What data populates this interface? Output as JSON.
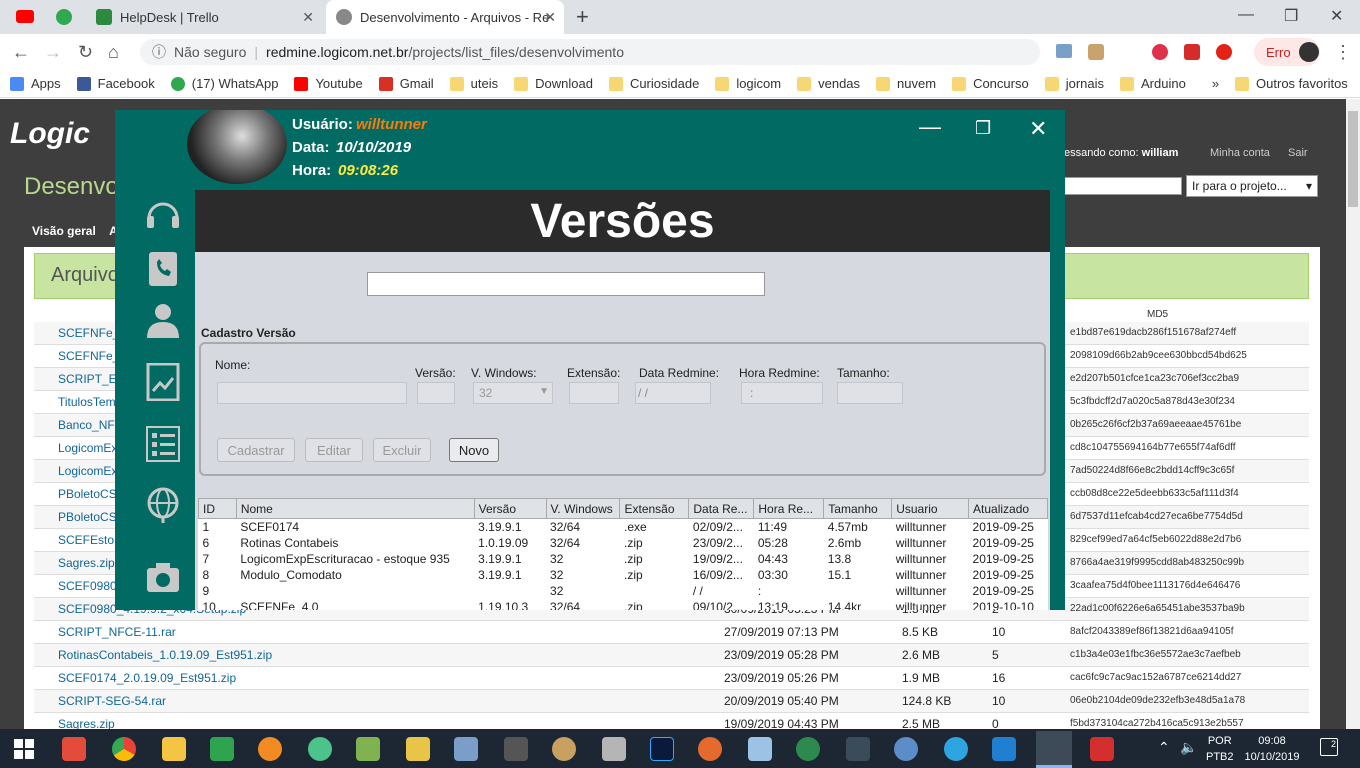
{
  "browser": {
    "tabs": [
      {
        "label": "HelpDesk | Trello"
      },
      {
        "label": "Desenvolvimento - Arquivos - Re"
      }
    ],
    "address_prefix": "Não seguro",
    "url_host": "redmine.logicom.net.br",
    "url_path": "/projects/list_files/desenvolvimento",
    "error_label": "Erro",
    "bookmarks": [
      "Apps",
      "Facebook",
      "(17) WhatsApp",
      "Youtube",
      "Gmail",
      "uteis",
      "Download",
      "Curiosidade",
      "logicom",
      "vendas",
      "nuvem",
      "Concurso",
      "jornais",
      "Arduino",
      "»",
      "Outros favoritos"
    ]
  },
  "redmine": {
    "logo": "Logic",
    "project": "Desenvo",
    "nav_first": "Visão geral",
    "nav_second": "A",
    "section_title": "Arquivo",
    "logged_prefix": "essando como:",
    "logged_user": "william",
    "my_account": "Minha conta",
    "logout": "Sair",
    "jump_label": "Ir para o projeto...",
    "md5_header": "MD5",
    "files": [
      {
        "name": "SCEFNFe_",
        "date": "",
        "size": "",
        "dl": "",
        "md5": "e1bd87e619dacb286f151678af274eff"
      },
      {
        "name": "SCEFNFe_",
        "date": "",
        "size": "",
        "dl": "",
        "md5": "2098109d66b2ab9cee630bbcd54bd625"
      },
      {
        "name": "SCRIPT_E",
        "date": "",
        "size": "",
        "dl": "",
        "md5": "e2d207b501cfce1ca23c706ef3cc2ba9"
      },
      {
        "name": "TitulosTem",
        "date": "",
        "size": "",
        "dl": "",
        "md5": "5c3fbdcff2d7a020c5a878d43e30f234"
      },
      {
        "name": "Banco_NF",
        "date": "",
        "size": "",
        "dl": "",
        "md5": "0b265c26f6cf2b37a69aeeaae45761be"
      },
      {
        "name": "LogicomEx",
        "date": "",
        "size": "",
        "dl": "",
        "md5": "cd8c104755694164b77e655f74af6dff"
      },
      {
        "name": "LogicomEx",
        "date": "",
        "size": "",
        "dl": "",
        "md5": "7ad50224d8f66e8c2bdd14cff9c3c65f"
      },
      {
        "name": "PBoletoCS",
        "date": "",
        "size": "",
        "dl": "",
        "md5": "ccb08d8ce22e5deebb633c5af111d3f4"
      },
      {
        "name": "PBoletoCS",
        "date": "",
        "size": "",
        "dl": "",
        "md5": "6d7537d11efcab4cd27eca6be7754d5d"
      },
      {
        "name": "SCEFEsto",
        "date": "",
        "size": "",
        "dl": "",
        "md5": "829cef99ed7a64cf5eb6022d88e2d7b6"
      },
      {
        "name": "Sagres.zip",
        "date": "",
        "size": "",
        "dl": "",
        "md5": "8766a4ae319f9995cdd8ab483250c99b"
      },
      {
        "name": "SCEF0980",
        "date": "",
        "size": "",
        "dl": "",
        "md5": "3caafea75d4f0bee1113176d4e646476"
      },
      {
        "name": "SCEF0980_4.19.9.2_x64.Setup.zip",
        "date": "30/09/2019 05:23 PM",
        "size": "1.5 MB",
        "dl": "2",
        "md5": "22ad1c00f6226e6a65451abe3537ba9b"
      },
      {
        "name": "SCRIPT_NFCE-11.rar",
        "date": "27/09/2019 07:13 PM",
        "size": "8.5 KB",
        "dl": "10",
        "md5": "8afcf2043389ef86f13821d6aa94105f"
      },
      {
        "name": "RotinasContabeis_1.0.19.09_Est951.zip",
        "date": "23/09/2019 05:28 PM",
        "size": "2.6 MB",
        "dl": "5",
        "md5": "c1b3a4e03e1fbc36e5572ae3c7aefbeb"
      },
      {
        "name": "SCEF0174_2.0.19.09_Est951.zip",
        "date": "23/09/2019 05:26 PM",
        "size": "1.9 MB",
        "dl": "16",
        "md5": "cac6fc9c7ac9ac152a6787ce6214dd27"
      },
      {
        "name": "SCRIPT-SEG-54.rar",
        "date": "20/09/2019 05:40 PM",
        "size": "124.8 KB",
        "dl": "10",
        "md5": "06e0b2104de09de232efb3e48d5a1a78"
      },
      {
        "name": "Sagres.zip",
        "date": "19/09/2019 04:43 PM",
        "size": "2.5 MB",
        "dl": "0",
        "md5": "f5bd373104ca272b416ca5c913e2b557"
      }
    ]
  },
  "app": {
    "user_label": "Usuário:",
    "user_value": "willtunner",
    "date_label": "Data:",
    "date_value": "10/10/2019",
    "time_label": "Hora:",
    "time_value": "09:08:26",
    "banner": "Versões",
    "section": "Cadastro Versão",
    "form": {
      "nome": "Nome:",
      "versao": "Versão:",
      "vwindows": "V. Windows:",
      "vwindows_value": "32",
      "extensao": "Extensão:",
      "data_redmine": "Data Redmine:",
      "data_value": " / /",
      "hora_redmine": "Hora Redmine:",
      "hora_value": ":",
      "tamanho": "Tamanho:"
    },
    "buttons": {
      "cadastrar": "Cadastrar",
      "editar": "Editar",
      "excluir": "Excluir",
      "novo": "Novo"
    },
    "columns": [
      "ID",
      "Nome",
      "Versão",
      "V. Windows",
      "Extensão",
      "Data Re...",
      "Hora Re...",
      "Tamanho",
      "Usuario",
      "Atualizado"
    ],
    "rows": [
      [
        "1",
        "SCEF0174",
        "3.19.9.1",
        "32/64",
        ".exe",
        "02/09/2...",
        "11:49",
        "4.57mb",
        "willtunner",
        "2019-09-25"
      ],
      [
        "6",
        "Rotinas Contabeis",
        "1.0.19.09",
        "32/64",
        ".zip",
        "23/09/2...",
        "05:28",
        "2.6mb",
        "willtunner",
        "2019-09-25"
      ],
      [
        "7",
        "LogicomExpEscrituracao - estoque 935",
        "3.19.9.1",
        "32",
        ".zip",
        "19/09/2...",
        "04:43",
        "13.8",
        "willtunner",
        "2019-09-25"
      ],
      [
        "8",
        "Modulo_Comodato",
        "3.19.9.1",
        "32",
        ".zip",
        "16/09/2...",
        "03:30",
        "15.1",
        "willtunner",
        "2019-09-25"
      ],
      [
        "9",
        "",
        "",
        "32",
        "",
        " / /",
        ":",
        "",
        "willtunner",
        "2019-09-25"
      ],
      [
        "10",
        "SCEFNFe_4.0",
        "1.19.10.3",
        "32/64",
        ".zip",
        "09/10/2...",
        "13:19",
        "14.4kr",
        "willtunner",
        "2019-10-10"
      ]
    ]
  },
  "taskbar": {
    "lang1": "POR",
    "lang2": "PTB2",
    "time": "09:08",
    "date": "10/10/2019",
    "notif": "2"
  }
}
